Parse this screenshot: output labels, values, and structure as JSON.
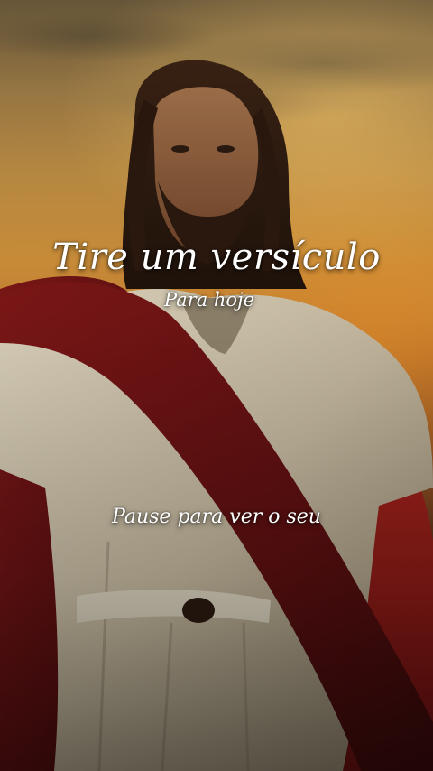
{
  "overlay": {
    "title": "Tire um versículo",
    "subtitle": "Para hoje",
    "call_to_action": "Pause para ver o seu"
  },
  "scene": {
    "description_icon": "robed-figure-sunset-image",
    "colors": {
      "sky": "#c98c38",
      "robe": "#e8e0cc",
      "sash": "#8a1c1c",
      "text": "#ffffff"
    }
  }
}
